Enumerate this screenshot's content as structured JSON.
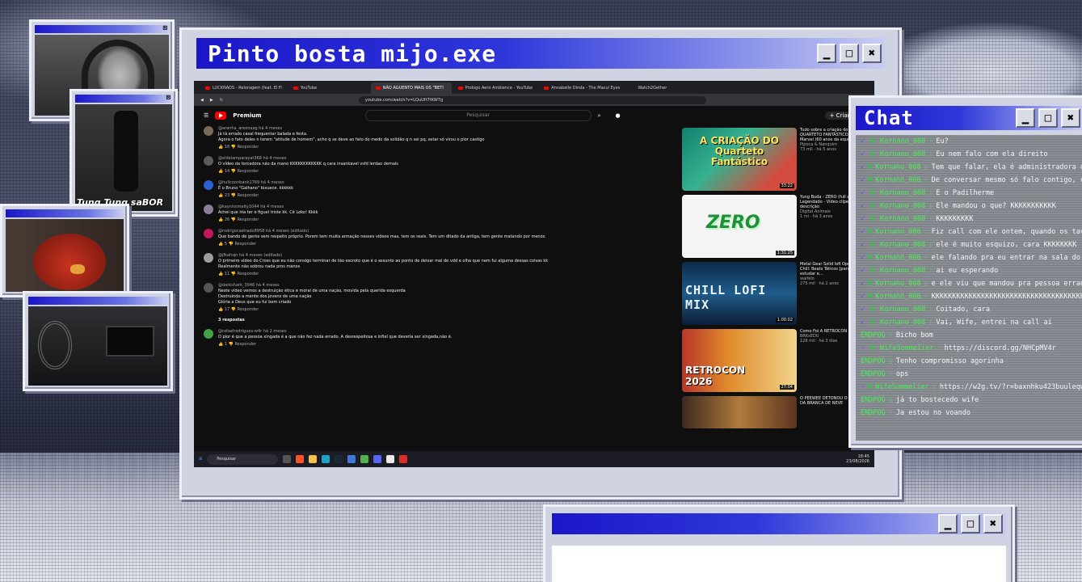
{
  "main_window": {
    "title": "Pinto bosta mijo.exe",
    "buttons": [
      "▁",
      "□",
      "✖"
    ]
  },
  "browser": {
    "tabs": [
      {
        "label": "LUCKNAOS - Reloragem (feat. El Fi"
      },
      {
        "label": "YouTube"
      },
      {
        "label": "NÃO AGUENTO MAIS OS \"BETI"
      },
      {
        "label": "Prologo Aero Ambience - YouTube"
      },
      {
        "label": "Annabelle Dinda - The Macul Eyes"
      },
      {
        "label": "Watch2Gether"
      }
    ],
    "url": "youtube.com/watch?v=LQuUH7tKW7g"
  },
  "youtube": {
    "premium_label": "Premium",
    "search_placeholder": "Pesquisar",
    "create_label": "+ Criar",
    "comments": [
      {
        "author": "@aranha_areonaag",
        "time": "há 4 meses",
        "lines": [
          "Já tá errado casal frequentar balada e festa.",
          "Agora o fato deles n terem \"atitude de homem\", acho q se deve ao fato do medo da solidão q n sei pq, estar só virou o pior castigo"
        ],
        "likes": "18",
        "avatar_color": "#7a6a5a"
      },
      {
        "author": "@eldelamparayat368",
        "time": "há 4 meses",
        "lines": [
          "O vídeo da torcedora não da mano KKKKKKKKKKKK q cara insankavel vsfd lerdao demais"
        ],
        "likes": "14",
        "avatar_color": "#5b5b5b"
      },
      {
        "author": "@hullcoonbank1769",
        "time": "há 4 meses",
        "lines": [
          "É o Bruno \"Galhano\" bixuece. kkkkkk"
        ],
        "likes": "23",
        "avatar_color": "#2e5fd1"
      },
      {
        "author": "@kaynissmelty1044",
        "time": "há 4 meses",
        "lines": [
          "Achei que iria ter e figuel triste kk. Cê Loko! Kkkk"
        ],
        "likes": "26",
        "avatar_color": "#8a7f9a"
      },
      {
        "author": "@rodrigocastrado8958",
        "time": "há 4 meses (editado)",
        "lines": [
          "Que bando de gente sem respeito próprio. Porem tem muita armação nesses videos mas, tem os reais. Tem um ditado da antiga, tem gente matando por menos."
        ],
        "likes": "5",
        "avatar_color": "#c2185b"
      },
      {
        "author": "@jfkahsjn",
        "time": "há 4 meses (editado)",
        "lines": [
          "O primeiro vídeo do Cross que eu não consigo terminar de tão escroto que é o assunto ao ponto de deixar mal de vdd e olha que nem fui alguma dessas coisas kk",
          "Realmente não sobrou nada pros manos"
        ],
        "likes": "11",
        "avatar_color": "#9e9e9e"
      },
      {
        "author": "@darkshark_3946",
        "time": "há 4 meses",
        "lines": [
          "Neste vídeo vemos a destruição ética e moral de uma nação, movida pela querida esquerda",
          "Destruindo a mente dos jovens de uma nação",
          "Glória a Deus que eu fui bem criado"
        ],
        "likes": "17",
        "avatar_color": "#555555"
      },
      {
        "author": "@rafaelrodrigues-w4r",
        "time": "há 2 meses",
        "lines": [
          "O pior é que a pessoa xingada é a que não fez nada errado. A desrespeitosa e infiel que deveria ser xingada,não é."
        ],
        "likes": "1",
        "avatar_color": "#43a047"
      }
    ],
    "replies_label": "3 respostas",
    "reply_label": "Responder",
    "sidebar": [
      {
        "title": "Tudo sobre a criação do QUARTETO FANTÁSTICO da Marvel (60 anos da equipe)",
        "channel": "Pipoca & Nanquim",
        "stats": "73 mil · há 5 anos",
        "duration": "33:22",
        "thumb_text": "A CRIAÇÃO DO Quarteto Fantástico"
      },
      {
        "title": "Yung Buda - ZERO (full album) - Legendado - Vídeo clipe - Leia a descrição",
        "channel": "Digital Animais",
        "stats": "1 mi · há 3 anos",
        "duration": "1:31:25",
        "thumb_text": "ZERO"
      },
      {
        "title": "Metal Gear Solid lofi Operações Chill: Beats Táticos [para estudar e...",
        "channel": "waifelo",
        "stats": "275 mil · há 2 anos",
        "duration": "1:00:02",
        "thumb_text": "CHILL LOFI MIX"
      },
      {
        "title": "Como Foi A RETROCON 2026!",
        "channel": "BRKsEDU",
        "stats": "128 mil · há 3 dias",
        "duration": "27:04",
        "thumb_text": "RETROCON 2026"
      },
      {
        "title": "O PEEWEE DETONOU O FILME DA BRANCA DE NEVE",
        "channel": "",
        "stats": "",
        "duration": "",
        "thumb_text": ""
      }
    ],
    "partial_top": {
      "likes": "9",
      "duration": "43:13"
    }
  },
  "taskbar": {
    "search": "Pesquisar",
    "lang": "POR PTB2",
    "time": "18:45",
    "date": "23/08/2026"
  },
  "cams": [
    {
      "label": ""
    },
    {
      "label": "Tung Tung saBOR"
    },
    {
      "label": ""
    },
    {
      "label": ""
    }
  ],
  "chat": {
    "title": "Chat",
    "messages": [
      {
        "user": "Kornano_008",
        "text": "Eu?",
        "badge": "check"
      },
      {
        "user": "Kornano_008",
        "text": "Eu nem falo com ela direito",
        "badge": "check"
      },
      {
        "user": "Kornano_008",
        "text": "Tem que falar, ela é administradora do canal del",
        "badge": "check"
      },
      {
        "user": "Kornano_008",
        "text": "De conversar mesmo só falo contigo, cara",
        "badge": "check"
      },
      {
        "user": "Kornano_008",
        "text": "E o Padilherme",
        "badge": "check"
      },
      {
        "user": "Kornano_008",
        "text": "Ele mandou o que? KKKKKKKKKKK",
        "badge": "check"
      },
      {
        "user": "Kornano_008",
        "text": "KKKKKKKKK",
        "badge": "check"
      },
      {
        "user": "Kornano_008",
        "text": "Fiz call com ele ontem, quando os tavam vendo",
        "badge": "check"
      },
      {
        "user": "Kornano_008",
        "text": "ele é muito esquizo, cara KKKKKKKK",
        "badge": "check"
      },
      {
        "user": "Kornano_008",
        "text": "ele falando pra eu entrar na sala do Kosmi",
        "badge": "check"
      },
      {
        "user": "Kornano_008",
        "text": "ai eu esperando",
        "badge": "check"
      },
      {
        "user": "Kornano_008",
        "text": "e ele viu que mandou pra pessoa errada",
        "badge": "check"
      },
      {
        "user": "Kornano_008",
        "text": "KKKKKKKKKKKKKKKKKKKKKKKKKKKKKKKKKKKKKKKKKKKK",
        "badge": "check"
      },
      {
        "user": "Kornano_008",
        "text": "Coitado, cara",
        "badge": "check"
      },
      {
        "user": "Kornano_008",
        "text": "Vai, Wife, entrei na call aí",
        "badge": "check"
      },
      {
        "user": "ENDPOG",
        "text": "Bicho bom",
        "badge": "none"
      },
      {
        "user": "WifeSommelier",
        "text": "https://discord.gg/NHCpMV4r",
        "badge": "purple"
      },
      {
        "user": "ENDPOG",
        "text": "Tenho compromisso agorinha",
        "badge": "none"
      },
      {
        "user": "ENDPOG",
        "text": "ops",
        "badge": "none"
      },
      {
        "user": "WifeSommelier",
        "text": "https://w2g.tv/?r=baxnhku423buuleqw2",
        "badge": "purple"
      },
      {
        "user": "ENDPOG",
        "text": "já to bostecedo wife",
        "badge": "none"
      },
      {
        "user": "ENDPOG",
        "text": "Ja estou no voando",
        "badge": "none"
      }
    ]
  },
  "colors": {
    "titlebar": "#1b17c9",
    "chat_user": "#45f04f",
    "chat_check": "#2d6bff",
    "yt_red": "#ff0000"
  }
}
